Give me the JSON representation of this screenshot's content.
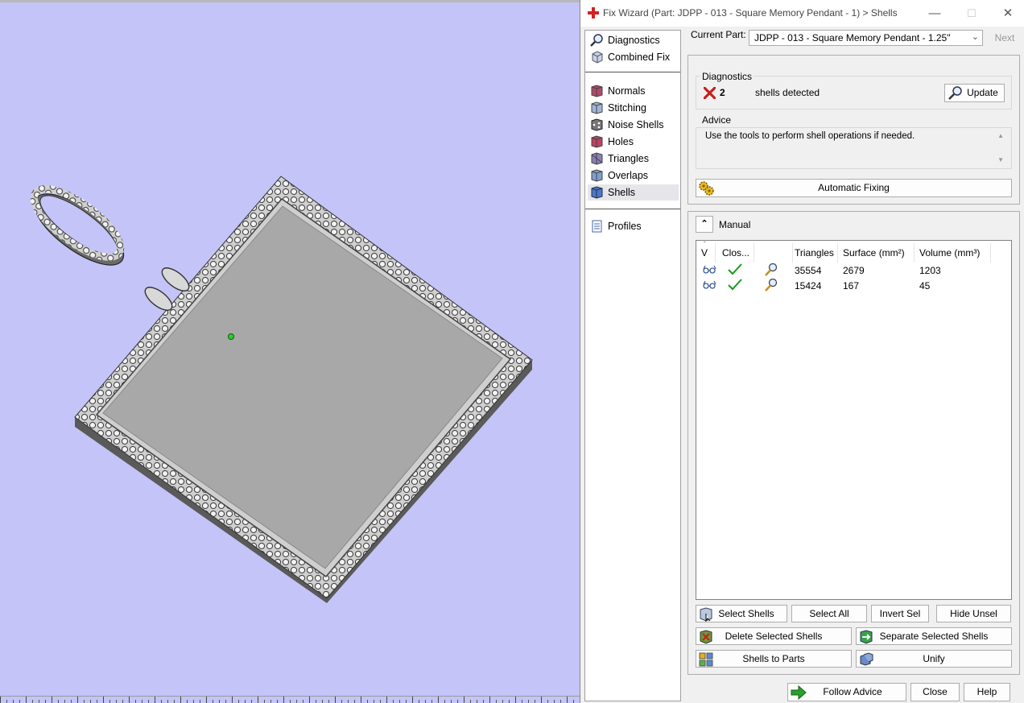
{
  "window": {
    "title": "Fix Wizard (Part: JDPP - 013 - Square Memory Pendant - 1) > Shells",
    "minimize": "—",
    "maximize": "☐",
    "close": "✕"
  },
  "nav": {
    "items": [
      {
        "label": "Diagnostics",
        "icon": "magnifier-icon"
      },
      {
        "label": "Combined Fix",
        "icon": "cube-icon"
      },
      {
        "label": "Normals",
        "icon": "normals-cube-icon"
      },
      {
        "label": "Stitching",
        "icon": "stitching-cube-icon"
      },
      {
        "label": "Noise Shells",
        "icon": "noise-dice-icon"
      },
      {
        "label": "Holes",
        "icon": "holes-cube-icon"
      },
      {
        "label": "Triangles",
        "icon": "triangles-cube-icon"
      },
      {
        "label": "Overlaps",
        "icon": "overlaps-cube-icon"
      },
      {
        "label": "Shells",
        "icon": "shells-cube-icon",
        "selected": true
      },
      {
        "label": "Profiles",
        "icon": "document-icon"
      }
    ]
  },
  "current_part": {
    "label": "Current Part:",
    "value": "JDPP - 013 - Square Memory Pendant - 1.25\"",
    "next": "Next"
  },
  "diagnostics": {
    "title": "Diagnostics",
    "count": "2",
    "text": "shells detected",
    "update": "Update"
  },
  "advice": {
    "title": "Advice",
    "text": "Use the tools to perform shell operations if needed."
  },
  "automatic_fixing": "Automatic Fixing",
  "manual": {
    "title": "Manual",
    "columns": [
      "V",
      "Clos...",
      "",
      "Triangles",
      "Surface (mm²)",
      "Volume (mm³)"
    ],
    "rows": [
      {
        "triangles": "35554",
        "surface": "2679",
        "volume": "1203"
      },
      {
        "triangles": "15424",
        "surface": "167",
        "volume": "45"
      }
    ]
  },
  "buttons": {
    "select_shells": "Select Shells",
    "select_all": "Select All",
    "invert_sel": "Invert Sel",
    "hide_unsel": "Hide Unsel",
    "delete_selected": "Delete Selected Shells",
    "separate_selected": "Separate Selected Shells",
    "shells_to_parts": "Shells to Parts",
    "unify": "Unify",
    "follow_advice": "Follow Advice",
    "close": "Close",
    "help": "Help"
  },
  "colors": {
    "viewport_bg": "#c4c4f8",
    "model_face": "#a8a8a8",
    "error_red": "#c8201c",
    "ok_green": "#1a9a1a",
    "follow_green": "#2aa02a"
  }
}
